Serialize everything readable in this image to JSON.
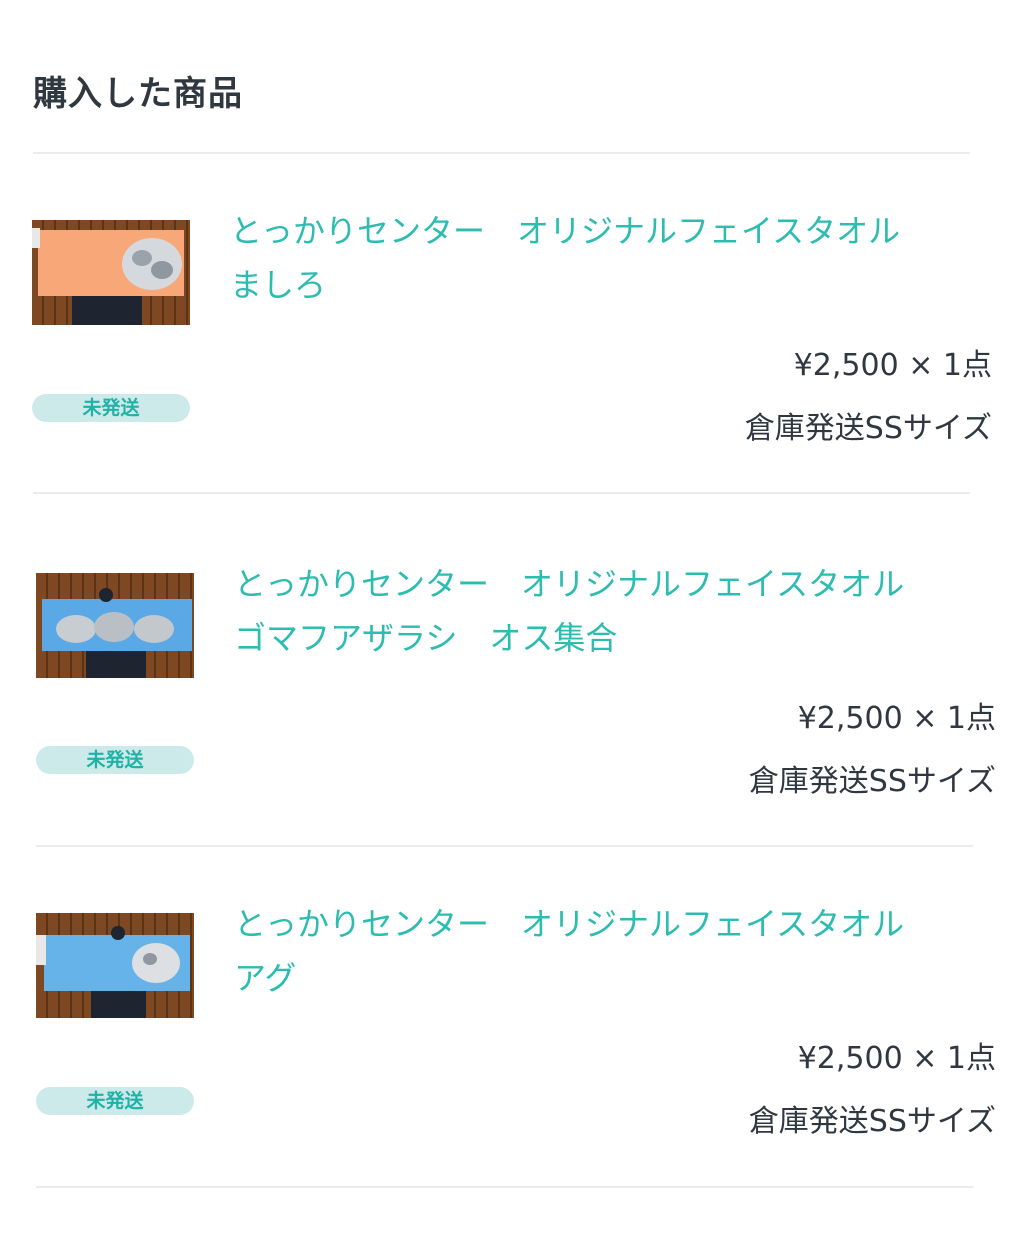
{
  "section": {
    "title": "購入した商品"
  },
  "items": [
    {
      "title_line1": "とっかりセンター　オリジナルフェイスタオル",
      "title_line2": "ましろ",
      "status": "未発送",
      "price": "¥2,500 × 1点",
      "shipping": "倉庫発送SSサイズ",
      "towel_color": "#f7a778"
    },
    {
      "title_line1": "とっかりセンター　オリジナルフェイスタオル",
      "title_line2": "ゴマフアザラシ　オス集合",
      "status": "未発送",
      "price": "¥2,500 × 1点",
      "shipping": "倉庫発送SSサイズ",
      "towel_color": "#5aa9e6"
    },
    {
      "title_line1": "とっかりセンター　オリジナルフェイスタオル",
      "title_line2": "アグ",
      "status": "未発送",
      "price": "¥2,500 × 1点",
      "shipping": "倉庫発送SSサイズ",
      "towel_color": "#66b3ea"
    }
  ],
  "colors": {
    "accent": "#2cbcb0",
    "badge_bg": "#cdeaea",
    "badge_text": "#1fb2a6",
    "text": "#2f3740",
    "divider": "#ececec"
  }
}
